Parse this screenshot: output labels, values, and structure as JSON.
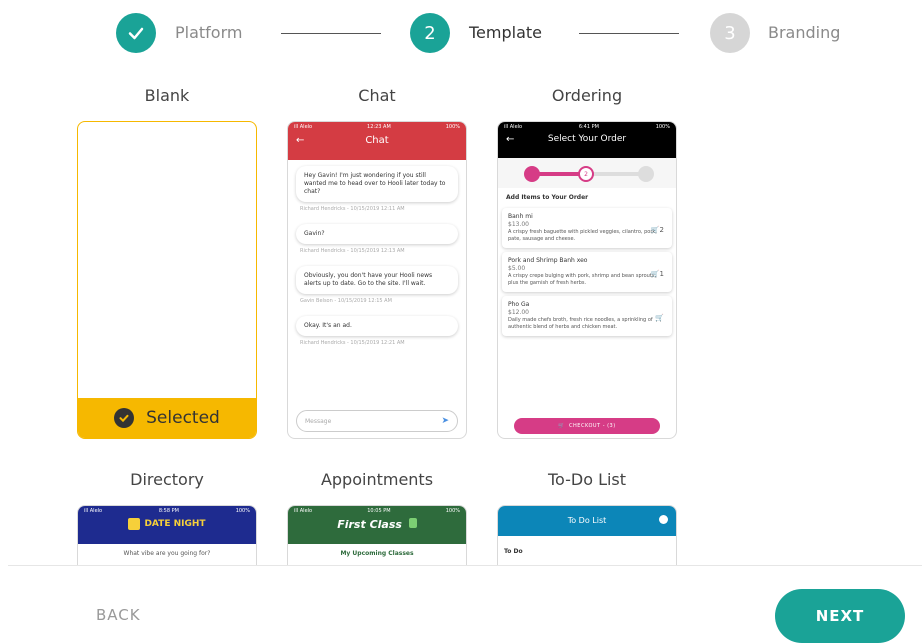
{
  "stepper": {
    "steps": [
      {
        "number": "",
        "label": "Platform",
        "state": "done"
      },
      {
        "number": "2",
        "label": "Template",
        "state": "active"
      },
      {
        "number": "3",
        "label": "Branding",
        "state": "todo"
      }
    ]
  },
  "templates": {
    "blank": {
      "title": "Blank",
      "selected_label": "Selected"
    },
    "chat": {
      "title": "Chat",
      "status_left": "ill Alelo",
      "status_time": "12:23 AM",
      "status_right": "100%",
      "header": "Chat",
      "messages": [
        {
          "text": "Hey Gavin! I'm just wondering if you still wanted me to head over to Hooli later today to chat?",
          "meta": "Richard Hendricks - 10/15/2019 12:11 AM"
        },
        {
          "text": "Gavin?",
          "meta": "Richard Hendricks - 10/15/2019 12:13 AM"
        },
        {
          "text": "Obviously, you don't have your Hooli news alerts up to date. Go to the site. I'll wait.",
          "meta": "Gavin Belson - 10/15/2019 12:15 AM"
        },
        {
          "text": "Okay. It's an ad.",
          "meta": "Richard Hendricks - 10/15/2019 12:21 AM"
        }
      ],
      "input_placeholder": "Message"
    },
    "ordering": {
      "title": "Ordering",
      "status_left": "ill Alelo",
      "status_time": "6:41 PM",
      "status_right": "100%",
      "header": "Select Your Order",
      "step_number": "2",
      "section": "Add Items to Your Order",
      "items": [
        {
          "name": "Banh mi",
          "price": "$13.00",
          "qty": "2",
          "desc": "A crispy fresh baguette with pickled veggies, cilantro, pork, pate, sausage and cheese."
        },
        {
          "name": "Pork and Shrimp Banh xeo",
          "price": "$5.00",
          "qty": "1",
          "desc": "A crispy crepe bulging with pork, shrimp and bean sprouts, plus the garnish of fresh herbs."
        },
        {
          "name": "Pho Ga",
          "price": "$12.00",
          "qty": "",
          "desc": "Daily made chefs broth, fresh rice noodles, a sprinkling of authentic blend of herbs and chicken meat."
        }
      ],
      "checkout": "CHECKOUT - (3)"
    },
    "directory": {
      "title": "Directory",
      "status_left": "ill Alelo",
      "status_time": "8:58 PM",
      "status_right": "100%",
      "brand": "DATE NIGHT",
      "prompt": "What vibe are you going for?"
    },
    "appointments": {
      "title": "Appointments",
      "status_left": "ill Alelo",
      "status_time": "10:05 PM",
      "status_right": "100%",
      "brand": "First Class",
      "subtitle": "My Upcoming Classes"
    },
    "todo": {
      "title": "To-Do List",
      "header": "To Do List",
      "section": "To Do"
    }
  },
  "footer": {
    "back": "BACK",
    "next": "NEXT"
  },
  "colors": {
    "accent": "#1aa397",
    "selected": "#f6b800",
    "chat": "#d43c43",
    "ordering": "#d63c86"
  }
}
